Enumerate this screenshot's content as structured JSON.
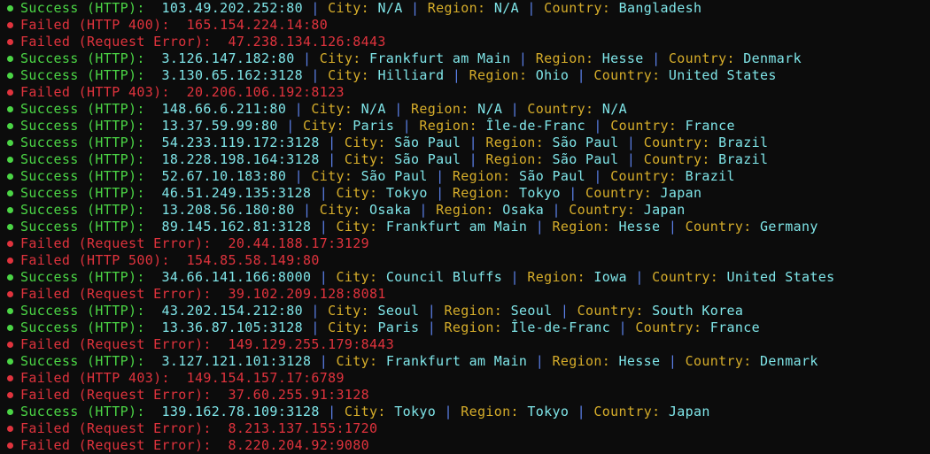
{
  "colors": {
    "background": "#0c0c0c",
    "success": "#4bd545",
    "failed": "#e0333d",
    "value": "#7fe5e8",
    "separator": "#5a7fe6",
    "label": "#d6ad2a"
  },
  "labels": {
    "city": "City:",
    "region": "Region:",
    "country": "Country:",
    "separator": "|"
  },
  "lines": [
    {
      "status": "success",
      "status_text": "Success (HTTP):",
      "address": "103.49.202.252:80",
      "city": "N/A",
      "region": "N/A",
      "country": "Bangladesh"
    },
    {
      "status": "failed",
      "status_text": "Failed (HTTP 400):",
      "address": "165.154.224.14:80"
    },
    {
      "status": "failed",
      "status_text": "Failed (Request Error):",
      "address": "47.238.134.126:8443"
    },
    {
      "status": "success",
      "status_text": "Success (HTTP):",
      "address": "3.126.147.182:80",
      "city": "Frankfurt am Main",
      "region": "Hesse",
      "country": "Denmark"
    },
    {
      "status": "success",
      "status_text": "Success (HTTP):",
      "address": "3.130.65.162:3128",
      "city": "Hilliard",
      "region": "Ohio",
      "country": "United States"
    },
    {
      "status": "failed",
      "status_text": "Failed (HTTP 403):",
      "address": "20.206.106.192:8123"
    },
    {
      "status": "success",
      "status_text": "Success (HTTP):",
      "address": "148.66.6.211:80",
      "city": "N/A",
      "region": "N/A",
      "country": "N/A"
    },
    {
      "status": "success",
      "status_text": "Success (HTTP):",
      "address": "13.37.59.99:80",
      "city": "Paris",
      "region": "Île-de-Franc",
      "country": "France"
    },
    {
      "status": "success",
      "status_text": "Success (HTTP):",
      "address": "54.233.119.172:3128",
      "city": "São Paul",
      "region": "São Paul",
      "country": "Brazil"
    },
    {
      "status": "success",
      "status_text": "Success (HTTP):",
      "address": "18.228.198.164:3128",
      "city": "São Paul",
      "region": "São Paul",
      "country": "Brazil"
    },
    {
      "status": "success",
      "status_text": "Success (HTTP):",
      "address": "52.67.10.183:80",
      "city": "São Paul",
      "region": "São Paul",
      "country": "Brazil"
    },
    {
      "status": "success",
      "status_text": "Success (HTTP):",
      "address": "46.51.249.135:3128",
      "city": "Tokyo",
      "region": "Tokyo",
      "country": "Japan"
    },
    {
      "status": "success",
      "status_text": "Success (HTTP):",
      "address": "13.208.56.180:80",
      "city": "Osaka",
      "region": "Osaka",
      "country": "Japan"
    },
    {
      "status": "success",
      "status_text": "Success (HTTP):",
      "address": "89.145.162.81:3128",
      "city": "Frankfurt am Main",
      "region": "Hesse",
      "country": "Germany"
    },
    {
      "status": "failed",
      "status_text": "Failed (Request Error):",
      "address": "20.44.188.17:3129"
    },
    {
      "status": "failed",
      "status_text": "Failed (HTTP 500):",
      "address": "154.85.58.149:80"
    },
    {
      "status": "success",
      "status_text": "Success (HTTP):",
      "address": "34.66.141.166:8000",
      "city": "Council Bluffs",
      "region": "Iowa",
      "country": "United States"
    },
    {
      "status": "failed",
      "status_text": "Failed (Request Error):",
      "address": "39.102.209.128:8081"
    },
    {
      "status": "success",
      "status_text": "Success (HTTP):",
      "address": "43.202.154.212:80",
      "city": "Seoul",
      "region": "Seoul",
      "country": "South Korea"
    },
    {
      "status": "success",
      "status_text": "Success (HTTP):",
      "address": "13.36.87.105:3128",
      "city": "Paris",
      "region": "Île-de-Franc",
      "country": "France"
    },
    {
      "status": "failed",
      "status_text": "Failed (Request Error):",
      "address": "149.129.255.179:8443"
    },
    {
      "status": "success",
      "status_text": "Success (HTTP):",
      "address": "3.127.121.101:3128",
      "city": "Frankfurt am Main",
      "region": "Hesse",
      "country": "Denmark"
    },
    {
      "status": "failed",
      "status_text": "Failed (HTTP 403):",
      "address": "149.154.157.17:6789"
    },
    {
      "status": "failed",
      "status_text": "Failed (Request Error):",
      "address": "37.60.255.91:3128"
    },
    {
      "status": "success",
      "status_text": "Success (HTTP):",
      "address": "139.162.78.109:3128",
      "city": "Tokyo",
      "region": "Tokyo",
      "country": "Japan"
    },
    {
      "status": "failed",
      "status_text": "Failed (Request Error):",
      "address": "8.213.137.155:1720"
    },
    {
      "status": "failed",
      "status_text": "Failed (Request Error):",
      "address": "8.220.204.92:9080"
    }
  ]
}
